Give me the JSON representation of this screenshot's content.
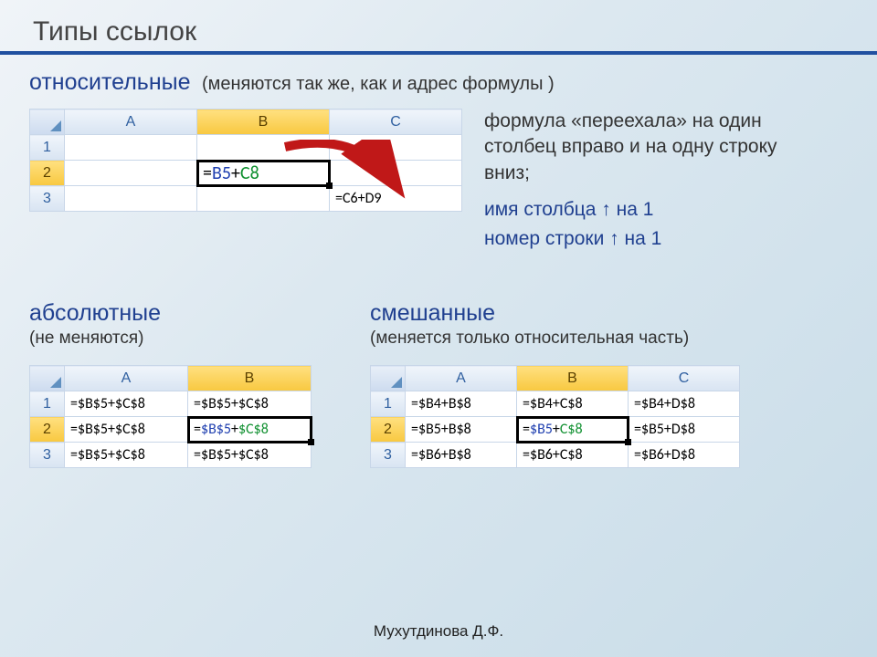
{
  "header": {
    "title": "Типы ссылок"
  },
  "relative": {
    "title": "относительные",
    "sub": "(меняются так же, как и адрес формулы )",
    "side1": "формула «переехала» на один столбец вправо и на одну строку вниз;",
    "side2a": "имя столбца ↑ на 1",
    "side2b": "номер строки ↑ на 1",
    "cols": [
      "A",
      "B",
      "C"
    ],
    "rows": [
      "1",
      "2",
      "3"
    ],
    "cellB2_eq": "=",
    "cellB2_p1": "B5",
    "cellB2_plus": "+",
    "cellB2_p2": "C8",
    "cellC3": "=C6+D9"
  },
  "absolute": {
    "title": "абсолютные",
    "sub": "(не меняются)",
    "cols": [
      "A",
      "B"
    ],
    "rows": [
      "1",
      "2",
      "3"
    ],
    "cells": {
      "A1": "=$B$5+$C$8",
      "B1": "=$B$5+$C$8",
      "A2": "=$B$5+$C$8",
      "B2_eq": "=",
      "B2_p1": "$B$5",
      "B2_plus": "+",
      "B2_p2": "$C$8",
      "A3": "=$B$5+$C$8",
      "B3": "=$B$5+$C$8"
    }
  },
  "mixed": {
    "title": "смешанные",
    "sub": "(меняется только относительная часть)",
    "cols": [
      "A",
      "B",
      "C"
    ],
    "rows": [
      "1",
      "2",
      "3"
    ],
    "cells": {
      "A1": "=$B4+B$8",
      "B1": "=$B4+C$8",
      "C1": "=$B4+D$8",
      "A2": "=$B5+B$8",
      "B2_eq": "=",
      "B2_p1": "$B5",
      "B2_plus": "+",
      "B2_p2": "C$8",
      "C2": "=$B5+D$8",
      "A3": "=$B6+B$8",
      "B3": "=$B6+C$8",
      "C3": "=$B6+D$8"
    }
  },
  "footer": "Мухутдинова Д.Ф."
}
